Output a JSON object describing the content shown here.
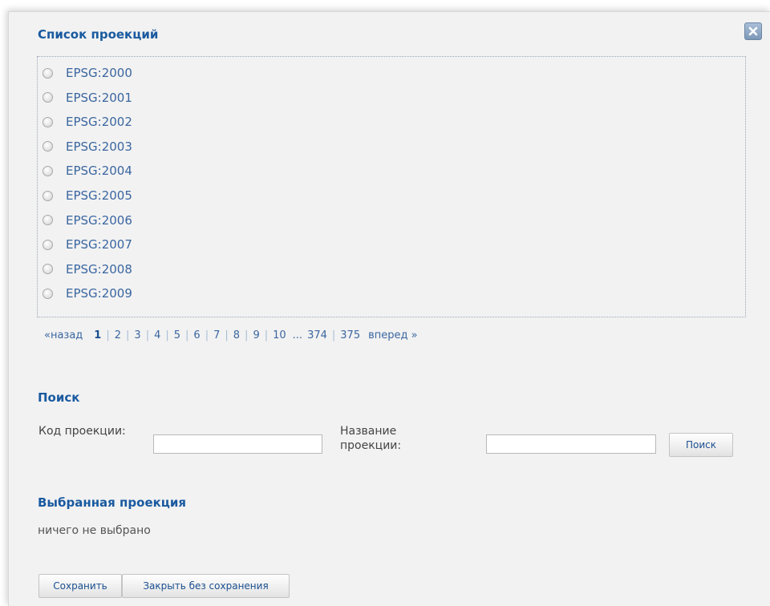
{
  "dialog": {
    "close_icon": "close-x-icon"
  },
  "projection_list": {
    "title": "Список проекций",
    "items": [
      {
        "label": "EPSG:2000",
        "selected": false
      },
      {
        "label": "EPSG:2001",
        "selected": false
      },
      {
        "label": "EPSG:2002",
        "selected": false
      },
      {
        "label": "EPSG:2003",
        "selected": false
      },
      {
        "label": "EPSG:2004",
        "selected": false
      },
      {
        "label": "EPSG:2005",
        "selected": false
      },
      {
        "label": "EPSG:2006",
        "selected": false
      },
      {
        "label": "EPSG:2007",
        "selected": false
      },
      {
        "label": "EPSG:2008",
        "selected": false
      },
      {
        "label": "EPSG:2009",
        "selected": false
      }
    ]
  },
  "pagination": {
    "prev": "«назад",
    "pages": [
      "1",
      "2",
      "3",
      "4",
      "5",
      "6",
      "7",
      "8",
      "9",
      "10"
    ],
    "current_page": "1",
    "ellipsis": "...",
    "tail_pages": [
      "374",
      "375"
    ],
    "next": "вперед »"
  },
  "search": {
    "title": "Поиск",
    "code_label": "Код проекции:",
    "code_value": "",
    "name_label": "Название проекции:",
    "name_value": "",
    "button_label": "Поиск"
  },
  "selected": {
    "title": "Выбранная проекция",
    "value": "ничего не выбрано"
  },
  "footer": {
    "save_label": "Сохранить",
    "close_label": "Закрыть без сохранения"
  },
  "colors": {
    "title": "#1a5aa0",
    "link": "#3a66a0",
    "background": "#f2f2f2"
  }
}
